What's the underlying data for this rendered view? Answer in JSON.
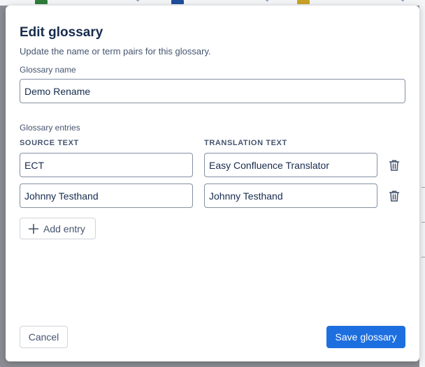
{
  "dialog": {
    "title": "Edit glossary",
    "subtitle": "Update the name or term pairs for this glossary.",
    "name_label": "Glossary name",
    "name_value": "Demo Rename",
    "entries_label": "Glossary entries",
    "columns": {
      "source": "SOURCE TEXT",
      "translation": "TRANSLATION TEXT"
    },
    "entries": [
      {
        "source": "ECT",
        "translation": "Easy Confluence Translator",
        "delete_icon": "trash-icon"
      },
      {
        "source": "Johnny Testhand",
        "translation": "Johnny Testhand",
        "delete_icon": "trash-icon"
      }
    ],
    "add_entry_label": "Add entry",
    "add_icon": "plus-icon",
    "cancel_label": "Cancel",
    "save_label": "Save glossary"
  },
  "colors": {
    "primary": "#1d6fe0",
    "text": "#172b4d",
    "subtle_text": "#44546f",
    "overlay": "#8a8d93"
  }
}
